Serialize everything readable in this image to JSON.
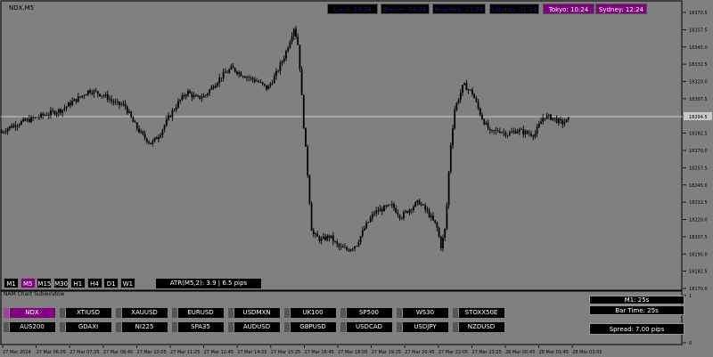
{
  "symbol_title": "NDX,M5",
  "clocks": [
    {
      "label": "Local: 19:24",
      "active": false
    },
    {
      "label": "Broker: 04:24",
      "active": false
    },
    {
      "label": "NewYork: 21:24",
      "active": false
    },
    {
      "label": "London: 01:24",
      "active": false
    },
    {
      "label": "Tokyo: 10:24",
      "active": true
    },
    {
      "label": "Sydney: 12:24",
      "active": true
    }
  ],
  "timeframes": [
    "M1",
    "M5",
    "M15",
    "M30",
    "H1",
    "H4",
    "D1",
    "W1"
  ],
  "active_timeframe": "M5",
  "atr_text": "ATR(M5,2): 3.9  |  6.5 pips",
  "subwindow_title": "NAM Chart Subwindow",
  "symbols_row1": [
    "NDX",
    "XTIUSD",
    "XAUUSD",
    "EURUSD",
    "USDMXN",
    "UK100",
    "SP500",
    "WS30",
    "STOXX50E"
  ],
  "symbols_row2": [
    "AUS200",
    "GDAXI",
    "NI225",
    "SPA35",
    "AUDUSD",
    "GBPUSD",
    "USDCAD",
    "USDJPY",
    "NZDUSD"
  ],
  "active_symbol": "NDX",
  "info": {
    "m1": "M1:  25s",
    "bar_time": "Bar Time: 25s",
    "spread": "Spread: 7.00 pips"
  },
  "price_axis": [
    "18370.5",
    "18357.5",
    "18345.0",
    "18332.5",
    "18320.0",
    "18307.5",
    "18295.0",
    "18282.5",
    "18270.0",
    "18257.5",
    "18245.0",
    "18232.5",
    "18220.0",
    "18207.5",
    "18195.0",
    "18182.5",
    "18170.0"
  ],
  "current_price": "18294.5",
  "sub_axis": [
    "1",
    "0"
  ],
  "time_axis": [
    "27 Mar 2024",
    "27 Mar 06:05",
    "27 Mar 07:25",
    "27 Mar 08:45",
    "27 Mar 10:05",
    "27 Mar 11:25",
    "27 Mar 12:45",
    "27 Mar 14:05",
    "27 Mar 15:25",
    "27 Mar 16:45",
    "27 Mar 18:05",
    "27 Mar 19:25",
    "27 Mar 20:45",
    "27 Mar 22:05",
    "27 Mar 23:25",
    "28 Mar 00:45",
    "28 Mar 01:45",
    "28 Mar 03:05"
  ],
  "chart_data": {
    "type": "candlestick",
    "symbol": "NDX",
    "timeframe": "M5",
    "ylim": [
      18170.0,
      18370.5
    ],
    "close_path": [
      [
        0,
        18283
      ],
      [
        10,
        18287
      ],
      [
        20,
        18290
      ],
      [
        30,
        18292
      ],
      [
        40,
        18294
      ],
      [
        50,
        18296
      ],
      [
        60,
        18298
      ],
      [
        70,
        18300
      ],
      [
        80,
        18305
      ],
      [
        90,
        18309
      ],
      [
        100,
        18314
      ],
      [
        110,
        18312
      ],
      [
        120,
        18309
      ],
      [
        130,
        18304
      ],
      [
        140,
        18303
      ],
      [
        150,
        18290
      ],
      [
        160,
        18281
      ],
      [
        170,
        18275
      ],
      [
        180,
        18283
      ],
      [
        190,
        18295
      ],
      [
        200,
        18305
      ],
      [
        210,
        18313
      ],
      [
        220,
        18308
      ],
      [
        230,
        18310
      ],
      [
        240,
        18318
      ],
      [
        250,
        18325
      ],
      [
        260,
        18330
      ],
      [
        270,
        18326
      ],
      [
        280,
        18323
      ],
      [
        290,
        18320
      ],
      [
        300,
        18315
      ],
      [
        310,
        18326
      ],
      [
        320,
        18340
      ],
      [
        330,
        18360
      ],
      [
        335,
        18345
      ],
      [
        340,
        18295
      ],
      [
        345,
        18255
      ],
      [
        350,
        18210
      ],
      [
        360,
        18205
      ],
      [
        370,
        18208
      ],
      [
        380,
        18200
      ],
      [
        390,
        18198
      ],
      [
        400,
        18202
      ],
      [
        410,
        18215
      ],
      [
        420,
        18225
      ],
      [
        430,
        18228
      ],
      [
        440,
        18230
      ],
      [
        450,
        18222
      ],
      [
        460,
        18228
      ],
      [
        470,
        18233
      ],
      [
        480,
        18225
      ],
      [
        490,
        18215
      ],
      [
        495,
        18200
      ],
      [
        500,
        18215
      ],
      [
        505,
        18270
      ],
      [
        510,
        18300
      ],
      [
        520,
        18318
      ],
      [
        530,
        18312
      ],
      [
        540,
        18295
      ],
      [
        550,
        18283
      ],
      [
        560,
        18285
      ],
      [
        570,
        18282
      ],
      [
        580,
        18285
      ],
      [
        590,
        18283
      ],
      [
        600,
        18282
      ],
      [
        610,
        18295
      ],
      [
        620,
        18294
      ],
      [
        630,
        18290
      ],
      [
        640,
        18293
      ]
    ]
  }
}
